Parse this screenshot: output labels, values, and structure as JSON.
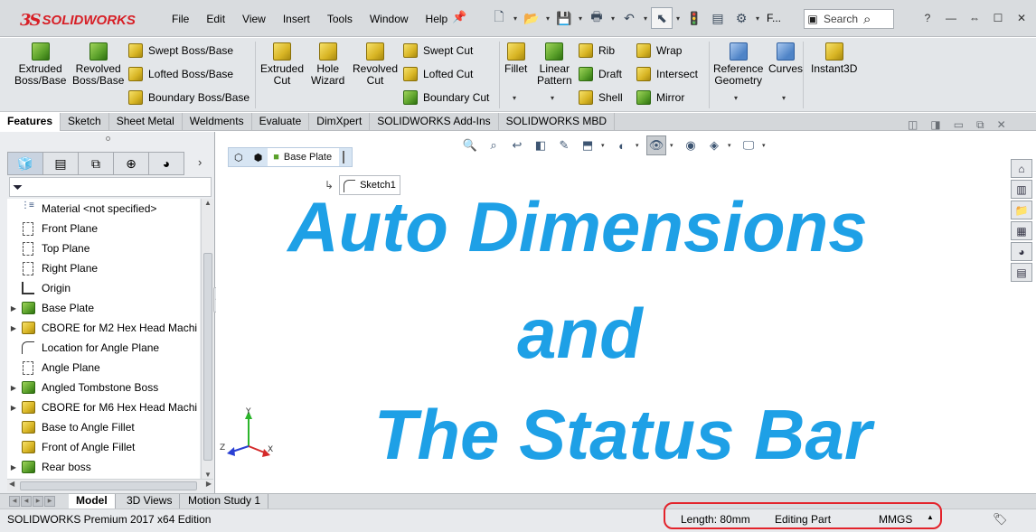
{
  "app": {
    "logo_prefix": "3S",
    "logo_text": "SOLIDWORKS"
  },
  "menu": {
    "items": [
      "File",
      "Edit",
      "View",
      "Insert",
      "Tools",
      "Window",
      "Help"
    ]
  },
  "quickbar": {
    "search_placeholder": "Search",
    "search_label": "F..."
  },
  "ribbon": {
    "extruded_boss": "Extruded\nBoss/Base",
    "revolved_boss": "Revolved\nBoss/Base",
    "swept_boss": "Swept Boss/Base",
    "lofted_boss": "Lofted Boss/Base",
    "boundary_boss": "Boundary Boss/Base",
    "extruded_cut": "Extruded\nCut",
    "hole_wizard": "Hole\nWizard",
    "revolved_cut": "Revolved\nCut",
    "swept_cut": "Swept Cut",
    "lofted_cut": "Lofted Cut",
    "boundary_cut": "Boundary Cut",
    "fillet": "Fillet",
    "linear_pattern": "Linear\nPattern",
    "rib": "Rib",
    "draft": "Draft",
    "shell": "Shell",
    "wrap": "Wrap",
    "intersect": "Intersect",
    "mirror": "Mirror",
    "reference_geometry": "Reference\nGeometry",
    "curves": "Curves",
    "instant3d": "Instant3D"
  },
  "tabs": [
    "Features",
    "Sketch",
    "Sheet Metal",
    "Weldments",
    "Evaluate",
    "DimXpert",
    "SOLIDWORKS Add-Ins",
    "SOLIDWORKS MBD"
  ],
  "tree": {
    "items": [
      {
        "label": "Material <not specified>",
        "icon": "material-icon"
      },
      {
        "label": "Front Plane",
        "icon": "plane-icon"
      },
      {
        "label": "Top Plane",
        "icon": "plane-icon"
      },
      {
        "label": "Right Plane",
        "icon": "plane-icon"
      },
      {
        "label": "Origin",
        "icon": "origin-icon"
      },
      {
        "label": "Base Plate",
        "icon": "extrude-feature-icon"
      },
      {
        "label": "CBORE for M2 Hex Head Machi",
        "icon": "hole-feature-icon"
      },
      {
        "label": "Location for Angle Plane",
        "icon": "sketch-icon"
      },
      {
        "label": "Angle Plane",
        "icon": "plane-icon"
      },
      {
        "label": "Angled Tombstone Boss",
        "icon": "extrude-feature-icon"
      },
      {
        "label": "CBORE for M6 Hex Head Machi",
        "icon": "hole-feature-icon"
      },
      {
        "label": "Base to Angle Fillet",
        "icon": "fillet-feature-icon"
      },
      {
        "label": "Front of Angle Fillet",
        "icon": "fillet-feature-icon"
      },
      {
        "label": "Rear boss",
        "icon": "extrude-feature-icon"
      }
    ]
  },
  "breadcrumb": {
    "part": "Base Plate",
    "sketch": "Sketch1"
  },
  "overlay": {
    "line1": "Auto Dimensions",
    "line2": "and",
    "line3": "The Status Bar"
  },
  "triad": {
    "x": "X",
    "y": "Y",
    "z": "Z"
  },
  "bottom_tabs": [
    "Model",
    "3D Views",
    "Motion Study 1"
  ],
  "status": {
    "edition": "SOLIDWORKS Premium 2017 x64 Edition",
    "length": "Length: 80mm",
    "mode": "Editing Part",
    "units": "MMGS"
  },
  "colors": {
    "overlay_text": "#1ea0e6",
    "highlight": "#e3232b",
    "brand": "#d71f26"
  }
}
